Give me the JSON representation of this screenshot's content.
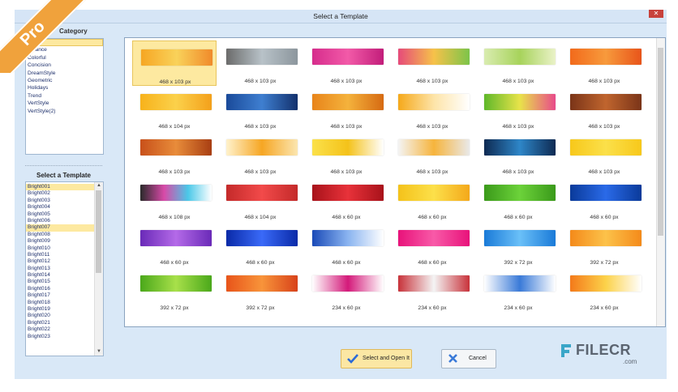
{
  "window": {
    "title": "Select a Template",
    "close": "✕"
  },
  "ribbon": {
    "text": "Pro"
  },
  "category": {
    "label": "Category",
    "items": [
      "",
      "Balance",
      "Colorful",
      "Concision",
      "DreamStyle",
      "Geometric",
      "Holidays",
      "Trend",
      "VertStyle",
      "VertStyle(2)"
    ],
    "selected_index": 0
  },
  "templates": {
    "label": "Select a Template",
    "items": [
      "Bright001",
      "Bright002",
      "Bright003",
      "Bright004",
      "Bright005",
      "Bright006",
      "Bright007",
      "Bright008",
      "Bright009",
      "Bright010",
      "Bright011",
      "Bright012",
      "Bright013",
      "Bright014",
      "Bright015",
      "Bright016",
      "Bright017",
      "Bright018",
      "Bright019",
      "Bright020",
      "Bright021",
      "Bright022",
      "Bright023"
    ],
    "selected_indices": [
      0,
      6
    ]
  },
  "grid": {
    "selected_index": 0,
    "cells": [
      {
        "size": "468 x 103 px",
        "bg": "linear-gradient(90deg,#f6a623,#f9d25a,#f08a2a)"
      },
      {
        "size": "468 x 103 px",
        "bg": "linear-gradient(90deg,#6b6b6b,#b8c2c8,#8c969d)"
      },
      {
        "size": "468 x 103 px",
        "bg": "linear-gradient(90deg,#d62c8c,#f25aa8,#c21d7a)"
      },
      {
        "size": "468 x 103 px",
        "bg": "linear-gradient(90deg,#e64a7a,#f6c24a,#7cc44a)"
      },
      {
        "size": "468 x 103 px",
        "bg": "linear-gradient(90deg,#d9ecb0,#a7d35b,#eaf2c8)"
      },
      {
        "size": "468 x 103 px",
        "bg": "linear-gradient(90deg,#f26a1b,#f79a3c,#e8541a)"
      },
      {
        "size": "468 x 104 px",
        "bg": "linear-gradient(90deg,#f7b21b,#fbd14b,#f4a01a)"
      },
      {
        "size": "468 x 103 px",
        "bg": "linear-gradient(90deg,#1a4a9a,#3f7fd0,#12306c)"
      },
      {
        "size": "468 x 103 px",
        "bg": "linear-gradient(90deg,#e8841a,#f4b23c,#d66a12)"
      },
      {
        "size": "468 x 103 px",
        "bg": "linear-gradient(90deg,#f5a81a,#fde4a8,#ffffff)"
      },
      {
        "size": "468 x 103 px",
        "bg": "linear-gradient(90deg,#5fb82a,#e8e34a,#e84a8a)"
      },
      {
        "size": "468 x 103 px",
        "bg": "linear-gradient(90deg,#7a3418,#c0652e,#7a3418)"
      },
      {
        "size": "468 x 103 px",
        "bg": "linear-gradient(90deg,#c8501a,#e88c3a,#a83e12)"
      },
      {
        "size": "468 x 103 px",
        "bg": "linear-gradient(90deg,#fff2cc,#f6a623,#fbe6b0)"
      },
      {
        "size": "468 x 103 px",
        "bg": "linear-gradient(90deg,#fbe14a,#f4c21a,#ffffff)"
      },
      {
        "size": "468 x 103 px",
        "bg": "linear-gradient(90deg,#f4f4f4,#f6b43c,#e9e9e9)"
      },
      {
        "size": "468 x 103 px",
        "bg": "linear-gradient(90deg,#0e2a52,#2e86c8,#0e2a52)"
      },
      {
        "size": "468 x 103 px",
        "bg": "linear-gradient(90deg,#f7c81a,#fbe04a,#f7c81a)"
      },
      {
        "size": "468 x 108 px",
        "bg": "linear-gradient(90deg,#2a2a2a,#d84aa8,#4ac8e8,#ffffff)"
      },
      {
        "size": "468 x 104 px",
        "bg": "linear-gradient(90deg,#c42a2a,#f24a4a,#c42a2a)"
      },
      {
        "size": "468 x 60 px",
        "bg": "linear-gradient(90deg,#a8121a,#e8323a,#a8121a)"
      },
      {
        "size": "468 x 60 px",
        "bg": "linear-gradient(90deg,#f4c21a,#fce04a,#f4a81a)"
      },
      {
        "size": "468 x 60 px",
        "bg": "linear-gradient(90deg,#3a9a1a,#6cd23a,#3a9a1a)"
      },
      {
        "size": "468 x 60 px",
        "bg": "linear-gradient(90deg,#0a3a9a,#2a6ae8,#0a3a9a)"
      },
      {
        "size": "468 x 60 px",
        "bg": "linear-gradient(90deg,#6a2ab8,#b46ae8,#6a2ab8)"
      },
      {
        "size": "468 x 60 px",
        "bg": "linear-gradient(90deg,#0a2aa8,#3a6af8,#0a2aa8)"
      },
      {
        "size": "468 x 60 px",
        "bg": "linear-gradient(90deg,#1a4ab8,#8ab4f0,#ffffff)"
      },
      {
        "size": "468 x 60 px",
        "bg": "linear-gradient(90deg,#e8127a,#f85aa8,#e8127a)"
      },
      {
        "size": "392 x 72 px",
        "bg": "linear-gradient(90deg,#1a7ad8,#6ac0f8,#1a7ad8)"
      },
      {
        "size": "392 x 72 px",
        "bg": "linear-gradient(90deg,#f48a1a,#fcc24a,#f48a1a)"
      },
      {
        "size": "392 x 72 px",
        "bg": "linear-gradient(90deg,#4aa81a,#a8e04a,#4aa81a)"
      },
      {
        "size": "392 x 72 px",
        "bg": "linear-gradient(90deg,#e8541a,#f8943a,#d8421a)"
      },
      {
        "size": "234 x 60 px",
        "bg": "linear-gradient(90deg,#ffffff,#d41a7a,#ffffff)"
      },
      {
        "size": "234 x 60 px",
        "bg": "linear-gradient(90deg,#c8323a,#f4f4f4,#c8323a)"
      },
      {
        "size": "234 x 60 px",
        "bg": "linear-gradient(90deg,#ffffff,#3a7ad8,#ffffff)"
      },
      {
        "size": "234 x 60 px",
        "bg": "linear-gradient(90deg,#f47a1a,#fcd24a,#ffffff)"
      }
    ]
  },
  "buttons": {
    "ok": "Select and Open It",
    "cancel": "Cancel"
  },
  "watermark": {
    "brand": "FILECR",
    "domain": ".com"
  }
}
